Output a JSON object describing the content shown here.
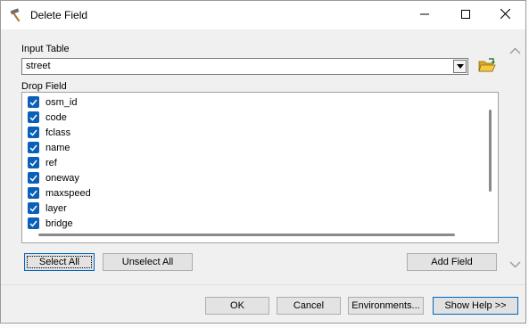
{
  "window": {
    "title": "Delete Field",
    "icons": {
      "app": "hammer-icon",
      "minimize": "minimize-icon",
      "maximize": "maximize-icon",
      "close": "close-icon"
    }
  },
  "input_table": {
    "label": "Input Table",
    "value": "street",
    "dropdown_icon": "chevron-down-icon",
    "browse_icon": "open-folder-icon"
  },
  "drop_field": {
    "label": "Drop Field",
    "items": [
      {
        "label": "osm_id",
        "checked": true
      },
      {
        "label": "code",
        "checked": true
      },
      {
        "label": "fclass",
        "checked": true
      },
      {
        "label": "name",
        "checked": true
      },
      {
        "label": "ref",
        "checked": true
      },
      {
        "label": "oneway",
        "checked": true
      },
      {
        "label": "maxspeed",
        "checked": true
      },
      {
        "label": "layer",
        "checked": true
      },
      {
        "label": "bridge",
        "checked": true
      }
    ]
  },
  "list_buttons": {
    "select_all": "Select All",
    "unselect_all": "Unselect All",
    "add_field": "Add Field"
  },
  "footer": {
    "ok": "OK",
    "cancel": "Cancel",
    "environments": "Environments...",
    "show_help": "Show Help >>"
  },
  "colors": {
    "checkbox": "#0a5fb8",
    "accent_border": "#0067c0",
    "window_bg": "#f0f0f0"
  }
}
